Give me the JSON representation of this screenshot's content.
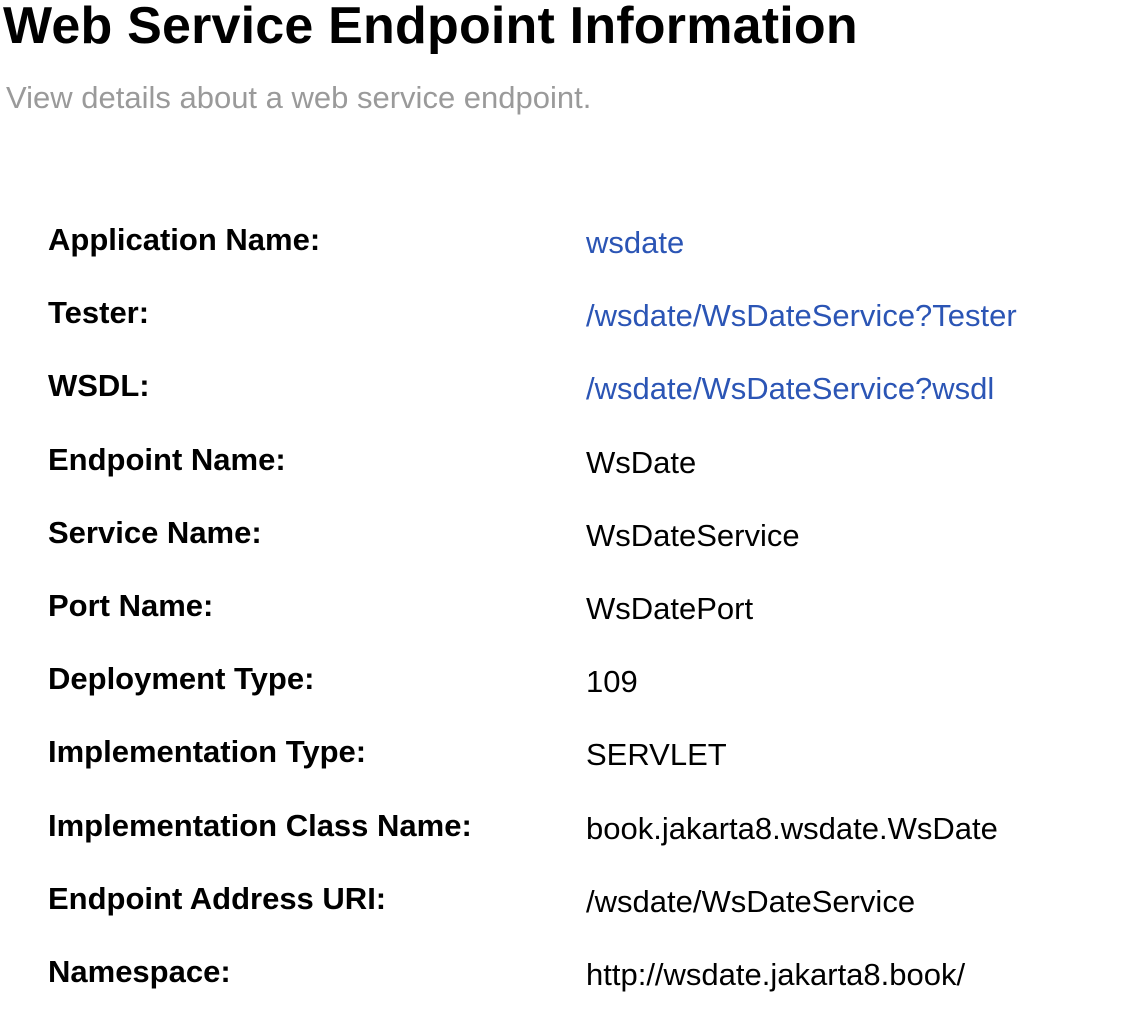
{
  "header": {
    "title": "Web Service Endpoint Information",
    "subtitle": "View details about a web service endpoint."
  },
  "colors": {
    "link": "#2b55b5",
    "subtitle": "#9a9a9a",
    "text": "#000000"
  },
  "properties": [
    {
      "label": "Application Name:",
      "value": "wsdate",
      "is_link": true
    },
    {
      "label": "Tester:",
      "value": "/wsdate/WsDateService?Tester",
      "is_link": true
    },
    {
      "label": "WSDL:",
      "value": "/wsdate/WsDateService?wsdl",
      "is_link": true
    },
    {
      "label": "Endpoint Name:",
      "value": "WsDate",
      "is_link": false
    },
    {
      "label": "Service Name:",
      "value": "WsDateService",
      "is_link": false
    },
    {
      "label": "Port Name:",
      "value": "WsDatePort",
      "is_link": false
    },
    {
      "label": "Deployment Type:",
      "value": "109",
      "is_link": false
    },
    {
      "label": "Implementation Type:",
      "value": "SERVLET",
      "is_link": false
    },
    {
      "label": "Implementation Class Name:",
      "value": "book.jakarta8.wsdate.WsDate",
      "is_link": false
    },
    {
      "label": "Endpoint Address URI:",
      "value": "/wsdate/WsDateService",
      "is_link": false
    },
    {
      "label": "Namespace:",
      "value": "http://wsdate.jakarta8.book/",
      "is_link": false
    }
  ]
}
